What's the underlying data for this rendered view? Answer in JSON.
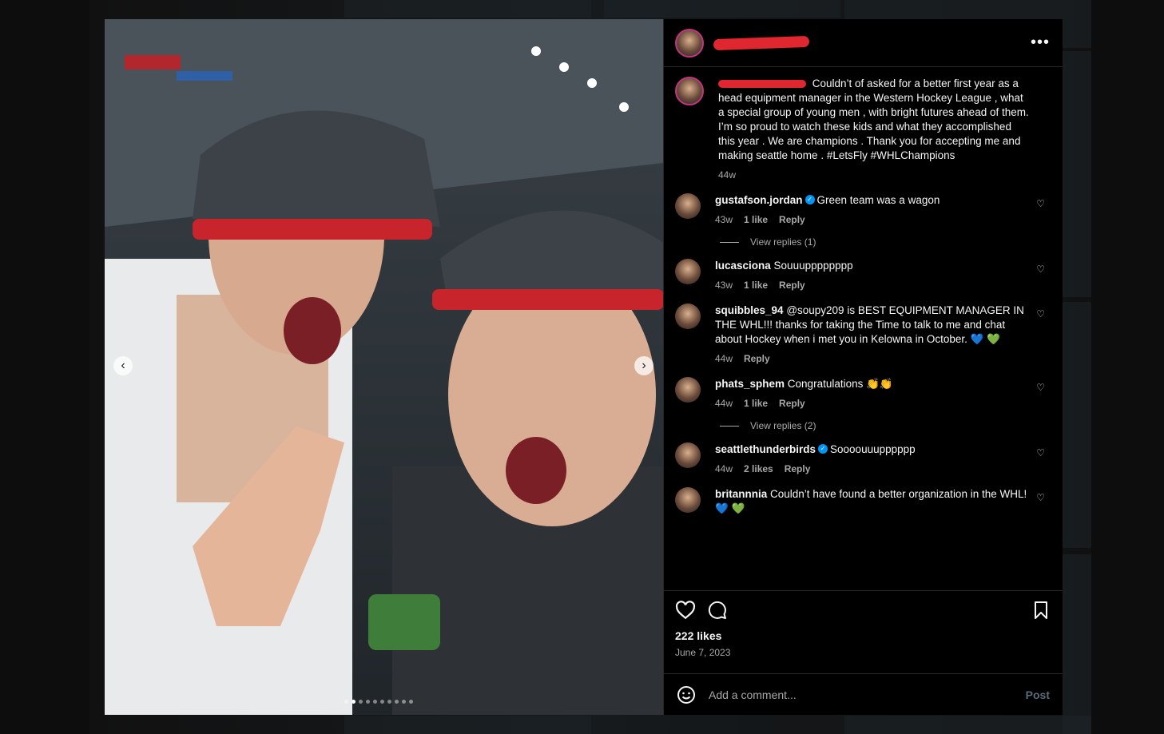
{
  "header": {
    "username": "[redacted]"
  },
  "caption": {
    "username": "[redacted]",
    "text": "Couldn’t of asked for a better first year as a head equipment manager in the Western Hockey League , what a special group of young men , with bright futures ahead of them. I’m so proud to watch these kids and what they accomplished this year . We are champions . Thank you for accepting me and making seattle home . #LetsFly #WHLChampions",
    "time": "44w"
  },
  "comments": [
    {
      "username": "gustafson.jordan",
      "verified": true,
      "text": "Green team was a wagon",
      "time": "43w",
      "likes": "1 like",
      "reply": "Reply",
      "view_replies": "View replies (1)"
    },
    {
      "username": "lucasciona",
      "verified": false,
      "text": "Souuupppppppp",
      "time": "43w",
      "likes": "1 like",
      "reply": "Reply"
    },
    {
      "username": "squibbles_94",
      "verified": false,
      "text": "@soupy209 is BEST EQUIPMENT MANAGER IN THE WHL!!! thanks for taking the Time to talk to me and chat about Hockey when i met you in Kelowna in October. 💙 💚",
      "time": "44w",
      "likes": "",
      "reply": "Reply"
    },
    {
      "username": "phats_sphem",
      "verified": false,
      "text": "Congratulations 👏👏",
      "time": "44w",
      "likes": "1 like",
      "reply": "Reply",
      "view_replies": "View replies (2)"
    },
    {
      "username": "seattlethunderbirds",
      "verified": true,
      "text": "Soooouuupppppp",
      "time": "44w",
      "likes": "2 likes",
      "reply": "Reply"
    },
    {
      "username": "britannnia",
      "verified": false,
      "text": "Couldn’t have found a better organization in the WHL! 💙 💚"
    }
  ],
  "actions": {
    "likes": "222 likes",
    "date": "June 7, 2023"
  },
  "composer": {
    "placeholder": "Add a comment...",
    "post_label": "Post"
  },
  "icons": {
    "more": "more-options-icon",
    "like": "heart-icon",
    "comment": "comment-bubble-icon",
    "save": "bookmark-icon",
    "emoji": "emoji-icon",
    "prev": "chevron-left-icon",
    "next": "chevron-right-icon"
  },
  "colors": {
    "background": "#000000",
    "muted": "#a8a8a8",
    "verified": "#0095f6",
    "redaction": "#e0262f"
  },
  "carousel": {
    "total": 10,
    "active": 1
  }
}
